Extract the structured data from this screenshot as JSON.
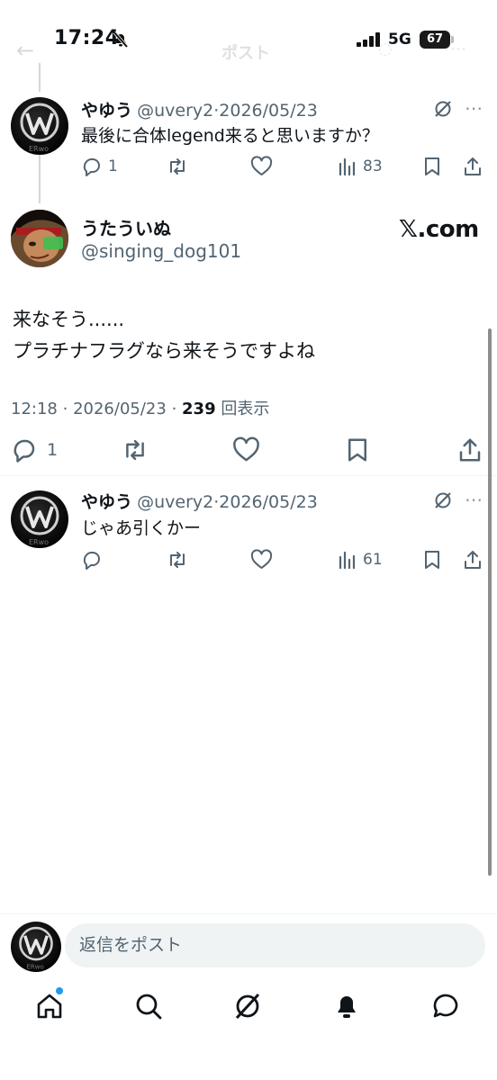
{
  "status_bar": {
    "time": "17:24",
    "network": "5G",
    "battery": "67"
  },
  "nav": {
    "title": "ポスト"
  },
  "parent_post": {
    "name": "やゆう",
    "handle": "@uvery2",
    "separator": "·",
    "date": "2026/05/23",
    "text": "最後に合体legend来ると思いますか？",
    "reply_count": "1",
    "view_count": "83"
  },
  "main_post": {
    "name": "うたういぬ",
    "handle": "@singing_dog101",
    "watermark": "𝕏.com",
    "line1": "来なそう......",
    "line2": "プラチナフラグなら来そうですよね",
    "time": "12:18",
    "separator": "·",
    "date": "2026/05/23",
    "views_number": "239",
    "views_label": "回表示",
    "reply_count": "1"
  },
  "reply_post": {
    "name": "やゆう",
    "handle": "@uvery2",
    "separator": "·",
    "date": "2026/05/23",
    "text": "じゃあ引くかー",
    "view_count": "61"
  },
  "reply_composer": {
    "placeholder": "返信をポスト"
  },
  "bottom_tabs": [
    "home",
    "search",
    "grok",
    "notifications",
    "messages"
  ],
  "colors": {
    "text": "#0f1419",
    "secondary": "#536471",
    "accent": "#1d9bf0",
    "divider": "#eff3f4"
  }
}
